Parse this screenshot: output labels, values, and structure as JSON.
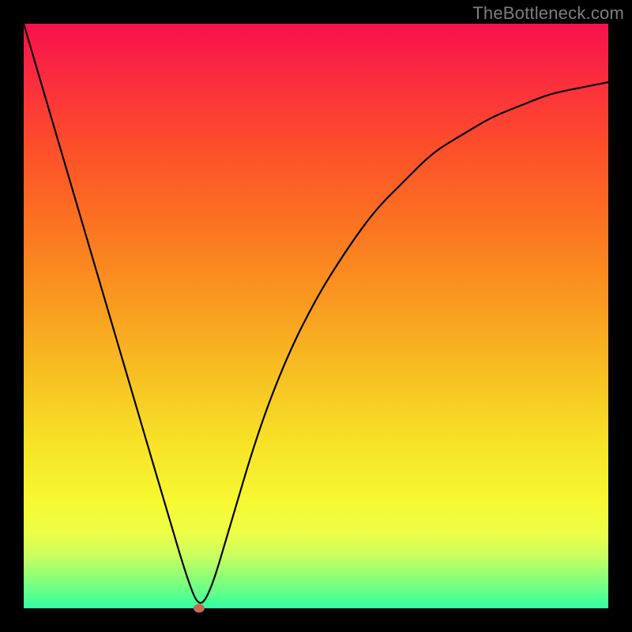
{
  "watermark": "TheBottleneck.com",
  "chart_data": {
    "type": "line",
    "title": "",
    "xlabel": "",
    "ylabel": "",
    "xlim": [
      0,
      1
    ],
    "ylim": [
      0,
      1
    ],
    "x": [
      0.0,
      0.05,
      0.1,
      0.15,
      0.2,
      0.25,
      0.28,
      0.3,
      0.32,
      0.35,
      0.4,
      0.45,
      0.5,
      0.55,
      0.6,
      0.65,
      0.7,
      0.75,
      0.8,
      0.85,
      0.9,
      0.95,
      1.0
    ],
    "values": [
      1.0,
      0.83,
      0.66,
      0.49,
      0.32,
      0.15,
      0.05,
      0.0,
      0.03,
      0.13,
      0.3,
      0.43,
      0.53,
      0.61,
      0.68,
      0.73,
      0.78,
      0.81,
      0.84,
      0.86,
      0.88,
      0.89,
      0.9
    ],
    "marker_point": {
      "x": 0.3,
      "y": 0.0
    },
    "grid": false,
    "legend": false
  },
  "colors": {
    "background": "#000000",
    "gradient_top": "#f7114c",
    "gradient_bottom": "#32ffa2",
    "curve": "#000000",
    "marker": "#c56a55",
    "watermark": "#7d7d7d"
  }
}
